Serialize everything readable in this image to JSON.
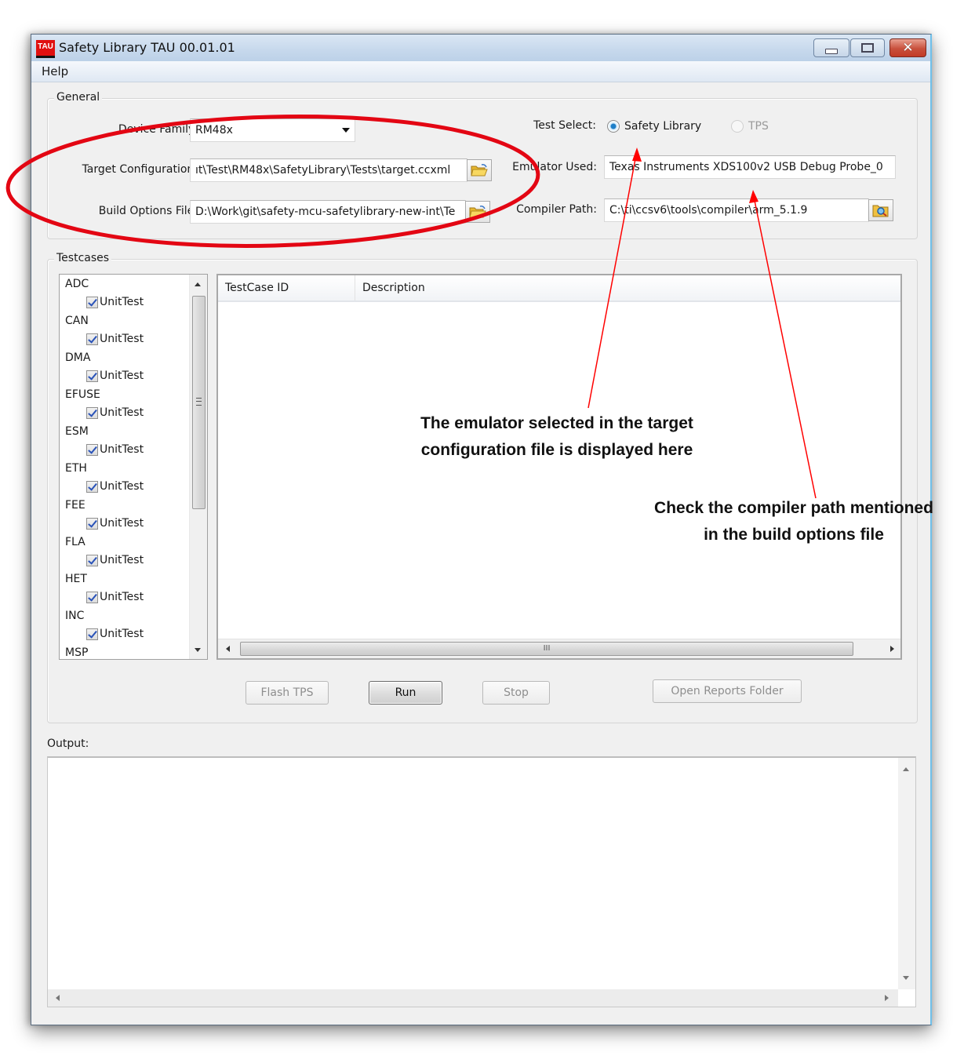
{
  "window": {
    "app_icon_text": "TAU",
    "title": "Safety Library TAU 00.01.01",
    "controls": {
      "minimize": "minimize",
      "maximize": "maximize",
      "close": "✕"
    }
  },
  "menu": {
    "items": [
      {
        "label": "Help"
      }
    ]
  },
  "general": {
    "group_label": "General",
    "device_family": {
      "label": "Device Family:",
      "value": "RM48x"
    },
    "target_configuration": {
      "label": "Target Configuration:",
      "value": "ıt\\Test\\RM48x\\SafetyLibrary\\Tests\\target.ccxml"
    },
    "build_options_file": {
      "label": "Build Options File:",
      "value": "D:\\Work\\git\\safety-mcu-safetylibrary-new-int\\Te"
    },
    "test_select": {
      "label": "Test Select:",
      "options": [
        {
          "label": "Safety Library",
          "selected": true,
          "enabled": true
        },
        {
          "label": "TPS",
          "selected": false,
          "enabled": false
        }
      ]
    },
    "emulator_used": {
      "label": "Emulator Used:",
      "value": "Texas Instruments XDS100v2 USB Debug Probe_0"
    },
    "compiler_path": {
      "label": "Compiler Path:",
      "value": "C:\\ti\\ccsv6\\tools\\compiler\\arm_5.1.9"
    }
  },
  "testcases": {
    "group_label": "Testcases",
    "tree": [
      {
        "module": "ADC",
        "child": "UnitTest",
        "checked": true
      },
      {
        "module": "CAN",
        "child": "UnitTest",
        "checked": true
      },
      {
        "module": "DMA",
        "child": "UnitTest",
        "checked": true
      },
      {
        "module": "EFUSE",
        "child": "UnitTest",
        "checked": true
      },
      {
        "module": "ESM",
        "child": "UnitTest",
        "checked": true
      },
      {
        "module": "ETH",
        "child": "UnitTest",
        "checked": true
      },
      {
        "module": "FEE",
        "child": "UnitTest",
        "checked": true
      },
      {
        "module": "FLA",
        "child": "UnitTest",
        "checked": true
      },
      {
        "module": "HET",
        "child": "UnitTest",
        "checked": true
      },
      {
        "module": "INC",
        "child": "UnitTest",
        "checked": true
      },
      {
        "module": "MSP",
        "child": null,
        "checked": null
      }
    ],
    "table": {
      "columns": [
        "TestCase ID",
        "Description"
      ],
      "rows": [],
      "hscroll_grip": "III"
    },
    "buttons": {
      "flash_tps": "Flash TPS",
      "run": "Run",
      "stop": "Stop",
      "open_reports": "Open Reports Folder"
    }
  },
  "output": {
    "label": "Output:",
    "text": ""
  },
  "annotations": {
    "emulator_note": [
      "The emulator selected in the target",
      "configuration file is displayed here"
    ],
    "compiler_note": [
      "Check the compiler path mentioned",
      "in the build options file"
    ],
    "highlight_color": "#e30613",
    "arrow_color": "#ff0000"
  }
}
